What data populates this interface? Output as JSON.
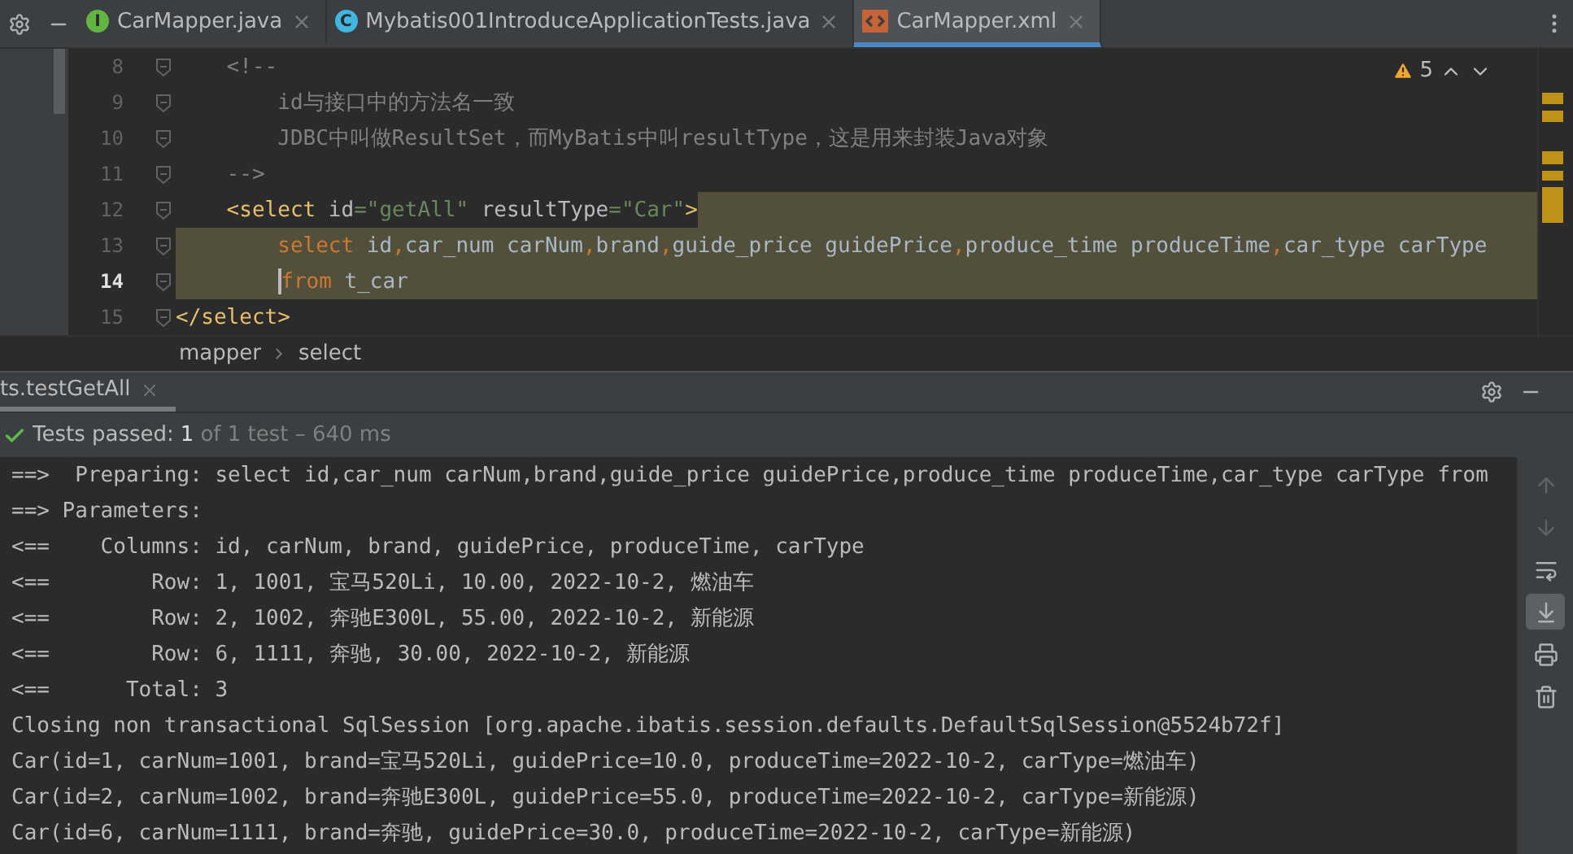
{
  "editor_tabs": [
    {
      "label": "CarMapper.java",
      "kind": "interface",
      "badge": "I",
      "selected": false
    },
    {
      "label": "Mybatis001IntroduceApplicationTests.java",
      "kind": "class",
      "badge": "C",
      "selected": false
    },
    {
      "label": "CarMapper.xml",
      "kind": "xml",
      "selected": true
    }
  ],
  "warnings": {
    "count": "5"
  },
  "code_lines": [
    {
      "number": "8",
      "current": false,
      "selected": false,
      "selection_start": false,
      "selection_end": false,
      "tokens": [
        {
          "text": "    <!--",
          "kind": "comment"
        }
      ]
    },
    {
      "number": "9",
      "current": false,
      "selected": false,
      "selection_start": false,
      "selection_end": false,
      "tokens": [
        {
          "text": "        id与接口中的方法名一致",
          "kind": "comment"
        }
      ]
    },
    {
      "number": "10",
      "current": false,
      "selected": false,
      "selection_start": false,
      "selection_end": false,
      "tokens": [
        {
          "text": "        JDBC中叫做ResultSet，而MyBatis中叫resultType，这是用来封装Java对象",
          "kind": "comment"
        }
      ]
    },
    {
      "number": "11",
      "current": false,
      "selected": false,
      "selection_start": false,
      "selection_end": false,
      "tokens": [
        {
          "text": "    -->",
          "kind": "comment"
        }
      ]
    },
    {
      "number": "12",
      "current": false,
      "selected": false,
      "selection_start": true,
      "selection_end": false,
      "tokens": [
        {
          "text": "    <select",
          "kind": "tag"
        },
        {
          "text": " id",
          "kind": "attr"
        },
        {
          "text": "=\"getAll\"",
          "kind": "string"
        },
        {
          "text": " resultType",
          "kind": "attr"
        },
        {
          "text": "=\"Car\"",
          "kind": "string"
        },
        {
          "text": ">",
          "kind": "tag"
        }
      ]
    },
    {
      "number": "13",
      "current": false,
      "selected": true,
      "selection_start": false,
      "selection_end": false,
      "tokens": [
        {
          "text": "        select",
          "kind": "keyword"
        },
        {
          "text": " id",
          "kind": "ident"
        },
        {
          "text": ",",
          "kind": "keyword"
        },
        {
          "text": "car_num carNum",
          "kind": "ident"
        },
        {
          "text": ",",
          "kind": "keyword"
        },
        {
          "text": "brand",
          "kind": "ident"
        },
        {
          "text": ",",
          "kind": "keyword"
        },
        {
          "text": "guide_price guidePrice",
          "kind": "ident"
        },
        {
          "text": ",",
          "kind": "keyword"
        },
        {
          "text": "produce_time produceTime",
          "kind": "ident"
        },
        {
          "text": ",",
          "kind": "keyword"
        },
        {
          "text": "car_type carType",
          "kind": "ident"
        }
      ]
    },
    {
      "number": "14",
      "current": true,
      "selected": true,
      "selection_start": false,
      "selection_end": false,
      "tokens": [
        {
          "text": "        from",
          "kind": "keyword"
        },
        {
          "text": " t_car",
          "kind": "ident"
        }
      ]
    },
    {
      "number": "15",
      "current": false,
      "selected": false,
      "selection_start": false,
      "selection_end": true,
      "tokens": [
        {
          "text": "    </select>",
          "kind": "tag"
        }
      ]
    }
  ],
  "breadcrumb": [
    "mapper",
    "select"
  ],
  "run_tab": {
    "label": "ts.testGetAll",
    "selected": true
  },
  "test_status": {
    "passed": true,
    "label": "Tests passed:",
    "count": "1",
    "detail": "of 1 test – 640 ms"
  },
  "console_lines": [
    "==>  Preparing: select id,car_num carNum,brand,guide_price guidePrice,produce_time produceTime,car_type carType from",
    "==> Parameters: ",
    "<==    Columns: id, carNum, brand, guidePrice, produceTime, carType",
    "<==        Row: 1, 1001, 宝马520Li, 10.00, 2022-10-2, 燃油车",
    "<==        Row: 2, 1002, 奔驰E300L, 55.00, 2022-10-2, 新能源",
    "<==        Row: 6, 1111, 奔驰, 30.00, 2022-10-2, 新能源",
    "<==      Total: 3",
    "Closing non transactional SqlSession [org.apache.ibatis.session.defaults.DefaultSqlSession@5524b72f]",
    "Car(id=1, carNum=1001, brand=宝马520Li, guidePrice=10.0, produceTime=2022-10-2, carType=燃油车)",
    "Car(id=2, carNum=1002, brand=奔驰E300L, guidePrice=55.0, produceTime=2022-10-2, carType=新能源)",
    "Car(id=6, carNum=1111, brand=奔驰, guidePrice=30.0, produceTime=2022-10-2, carType=新能源)"
  ],
  "console_tools": [
    {
      "kind": "up",
      "disabled": true,
      "selected": false
    },
    {
      "kind": "down",
      "disabled": true,
      "selected": false
    },
    {
      "kind": "wrap",
      "disabled": false,
      "selected": false
    },
    {
      "kind": "scroll-end",
      "disabled": false,
      "selected": true
    },
    {
      "kind": "print",
      "disabled": false,
      "selected": false
    },
    {
      "kind": "trash",
      "disabled": false,
      "selected": false
    }
  ]
}
